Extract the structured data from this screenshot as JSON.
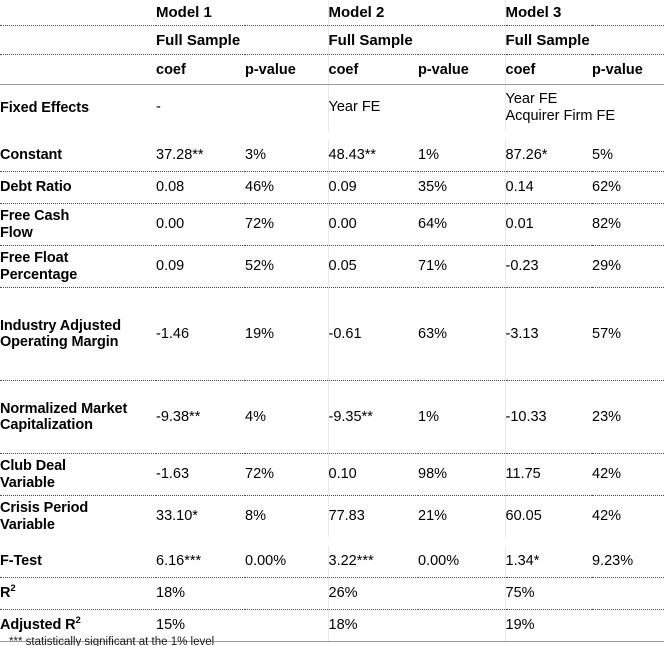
{
  "document": {
    "type": "regression-results-table",
    "footnote": "*** statistically significant at the 1% level"
  },
  "header": {
    "models": [
      "Model 1",
      "Model 2",
      "Model 3"
    ],
    "samples": [
      "Full Sample",
      "Full Sample",
      "Full Sample"
    ],
    "subheaders": [
      "coef",
      "p-value",
      "coef",
      "p-value",
      "coef",
      "p-value"
    ],
    "label_blank": ""
  },
  "fixed_effects": {
    "label": "Fixed Effects",
    "model1": "-",
    "model2": "Year FE",
    "model3_line1": "Year FE",
    "model3_line2": "Acquirer Firm FE"
  },
  "rows": [
    {
      "label": "Constant",
      "label_line2": "",
      "coef1": "37.28**",
      "pval1": "3%",
      "coef2": "48.43**",
      "pval2": "1%",
      "coef3": "87.26*",
      "pval3": "5%"
    },
    {
      "label": "Debt Ratio",
      "label_line2": "",
      "coef1": "0.08",
      "pval1": "46%",
      "coef2": "0.09",
      "pval2": "35%",
      "coef3": "0.14",
      "pval3": "62%"
    },
    {
      "label": "Free Cash",
      "label_line2": "Flow",
      "coef1": "0.00",
      "pval1": "72%",
      "coef2": "0.00",
      "pval2": "64%",
      "coef3": "0.01",
      "pval3": "82%"
    },
    {
      "label": "Free Float",
      "label_line2": "Percentage",
      "coef1": "0.09",
      "pval1": "52%",
      "coef2": "0.05",
      "pval2": "71%",
      "coef3": "-0.23",
      "pval3": "29%"
    },
    {
      "label": "Industry Adjusted Operating Margin",
      "label_line2": "",
      "coef1": "-1.46",
      "pval1": "19%",
      "coef2": "-0.61",
      "pval2": "63%",
      "coef3": "-3.13",
      "pval3": "57%"
    },
    {
      "label": "Normalized Market Capitalization",
      "label_line2": "",
      "coef1": "-9.38**",
      "pval1": "4%",
      "coef2": "-9.35**",
      "pval2": "1%",
      "coef3": "-10.33",
      "pval3": "23%"
    },
    {
      "label": "Club Deal",
      "label_line2": "Variable",
      "coef1": "-1.63",
      "pval1": "72%",
      "coef2": "0.10",
      "pval2": "98%",
      "coef3": "11.75",
      "pval3": "42%"
    },
    {
      "label": "Crisis Period",
      "label_line2": "Variable",
      "coef1": "33.10*",
      "pval1": "8%",
      "coef2": "77.83",
      "pval2": "21%",
      "coef3": "60.05",
      "pval3": "42%"
    }
  ],
  "statistics": [
    {
      "label": "F-Test",
      "label_sup": "",
      "coef1": "6.16***",
      "pval1": "0.00%",
      "coef2": "3.22***",
      "pval2": "0.00%",
      "coef3": "1.34*",
      "pval3": "9.23%"
    },
    {
      "label": "R",
      "label_sup": "2",
      "coef1": "18%",
      "pval1": "",
      "coef2": "26%",
      "pval2": "",
      "coef3": "75%",
      "pval3": ""
    },
    {
      "label": "Adjusted R",
      "label_sup": "2",
      "coef1": "15%",
      "pval1": "",
      "coef2": "18%",
      "pval2": "",
      "coef3": "19%",
      "pval3": ""
    }
  ]
}
